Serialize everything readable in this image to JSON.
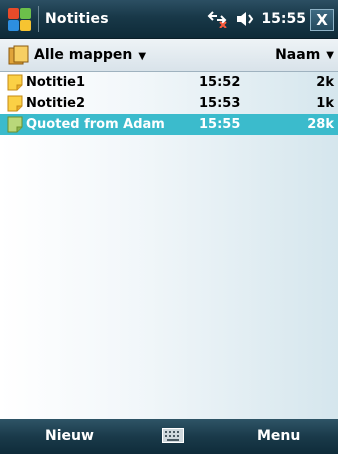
{
  "titlebar": {
    "app_title": "Notities",
    "time": "15:55",
    "close_label": "X",
    "icons": [
      "start-menu-icon",
      "connectivity-icon",
      "volume-icon"
    ]
  },
  "header": {
    "folder_label": "Alle mappen",
    "sort_label": "Naam"
  },
  "notes": [
    {
      "name": "Notitie1",
      "time": "15:52",
      "size": "2k",
      "selected": false
    },
    {
      "name": "Notitie2",
      "time": "15:53",
      "size": "1k",
      "selected": false
    },
    {
      "name": "Quoted from Adam",
      "time": "15:55",
      "size": "28k",
      "selected": true
    }
  ],
  "softkeys": {
    "left": "Nieuw",
    "right": "Menu"
  },
  "colors": {
    "titlebar": "#183848",
    "selection": "#3bbbcc",
    "softkey_bar": "#1a3a4a"
  }
}
